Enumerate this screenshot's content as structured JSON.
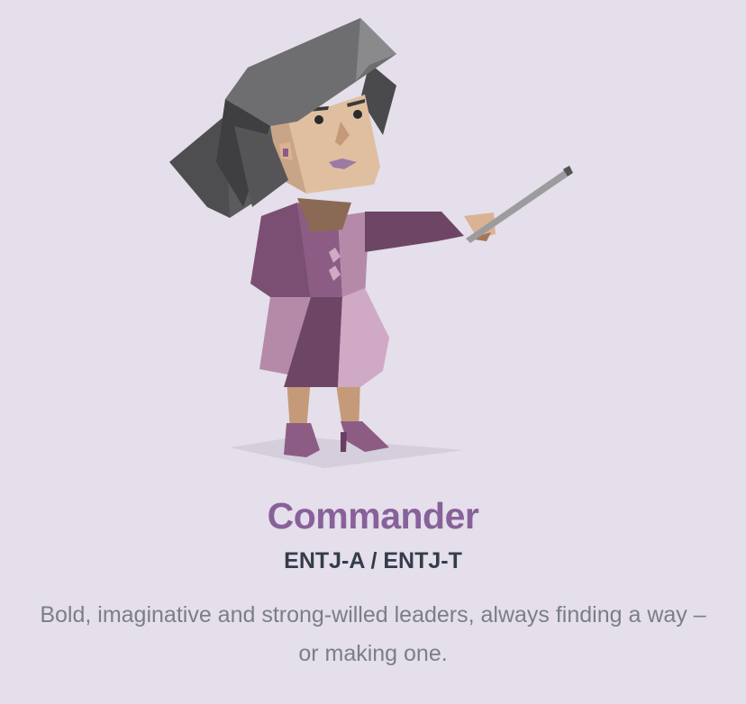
{
  "personality": {
    "name": "Commander",
    "codes": "ENTJ-A / ENTJ-T",
    "description": "Bold, imaginative and strong-willed leaders, always finding a way – or making one."
  },
  "colors": {
    "background": "#e4dfea",
    "accent": "#88619a",
    "code_text": "#343c4b",
    "description_text": "#7b7e88"
  }
}
